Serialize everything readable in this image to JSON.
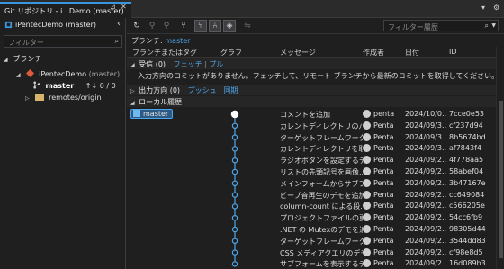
{
  "window": {
    "tab_title": "Git リポジトリ - i...Demo (master)",
    "pin_icon": "pin-icon",
    "close_icon": "close-icon"
  },
  "left": {
    "repo_name": "iPentecDemo (master)",
    "filter_placeholder": "フィルター",
    "branches_header": "ブランチ",
    "repo_node": "iPentecDemo",
    "repo_node_suffix": "(master)",
    "master_label": "master",
    "master_sync": "↑↓ 0 / 0",
    "remotes_label": "remotes/origin"
  },
  "toolbar": {
    "filter_placeholder": "フィルター履歴",
    "branch_prefix": "ブランチ:",
    "branch_name": "master"
  },
  "columns": {
    "branch_tag": "ブランチまたはタグ",
    "graph": "グラフ",
    "message": "メッセージ",
    "author": "作成者",
    "date": "日付",
    "id": "ID"
  },
  "incoming": {
    "label": "受信 (0)",
    "fetch": "フェッチ",
    "pull": "プル",
    "sep": "|",
    "empty_message": "入力方向のコミットがありません。フェッチして、リモート ブランチから最新のコミットを取得してください。"
  },
  "outgoing": {
    "label": "出力方向 (0)",
    "push": "プッシュ",
    "sync": "同期",
    "sep": "|"
  },
  "local": {
    "label": "ローカル履歴",
    "branch_badge": "master"
  },
  "commits": [
    {
      "message": "コメントを追加",
      "author": "penta",
      "date": "2024/10/0...",
      "id": "7cce0e53"
    },
    {
      "message": "カレントディレクトリのパス...",
      "author": "Penta",
      "date": "2024/09/3...",
      "id": "cf237d94"
    },
    {
      "message": "ターゲットフレームワークの...",
      "author": "Penta",
      "date": "2024/09/3...",
      "id": "8b5674bd"
    },
    {
      "message": "カレントディレクトリを取得...",
      "author": "Penta",
      "date": "2024/09/3...",
      "id": "af7843f4"
    },
    {
      "message": "ラジオボタンを設定するデ...",
      "author": "Penta",
      "date": "2024/09/2...",
      "id": "4f778aa5"
    },
    {
      "message": "リストの先頭記号を画像...",
      "author": "Penta",
      "date": "2024/09/2...",
      "id": "58abef04"
    },
    {
      "message": "メインフォームからサブフォー...",
      "author": "Penta",
      "date": "2024/09/2...",
      "id": "3b47167e"
    },
    {
      "message": "ビープ音再生のデモを追加...",
      "author": "Penta",
      "date": "2024/09/2...",
      "id": "cc649084"
    },
    {
      "message": "column-count による段...",
      "author": "Penta",
      "date": "2024/09/2...",
      "id": "c566205e"
    },
    {
      "message": "プロジェクトファイルの更新",
      "author": "Penta",
      "date": "2024/09/2...",
      "id": "54cc6fb9"
    },
    {
      "message": ".NET の Mutexのデモを追...",
      "author": "Penta",
      "date": "2024/09/2...",
      "id": "98305d44"
    },
    {
      "message": "ターゲットフレームワークの...",
      "author": "Penta",
      "date": "2024/09/2...",
      "id": "3544dd83"
    },
    {
      "message": "CSS メディアクエリのデモを...",
      "author": "Penta",
      "date": "2024/09/2...",
      "id": "cf98e8d5"
    },
    {
      "message": "サブフォームを表示するデモ...",
      "author": "Penta",
      "date": "2024/09/2...",
      "id": "16d089b3"
    }
  ],
  "colors": {
    "accent": "#3a96dd",
    "link": "#4ea6ea",
    "graph": "#4ea6ea",
    "badge_bg": "#2d5a85"
  }
}
